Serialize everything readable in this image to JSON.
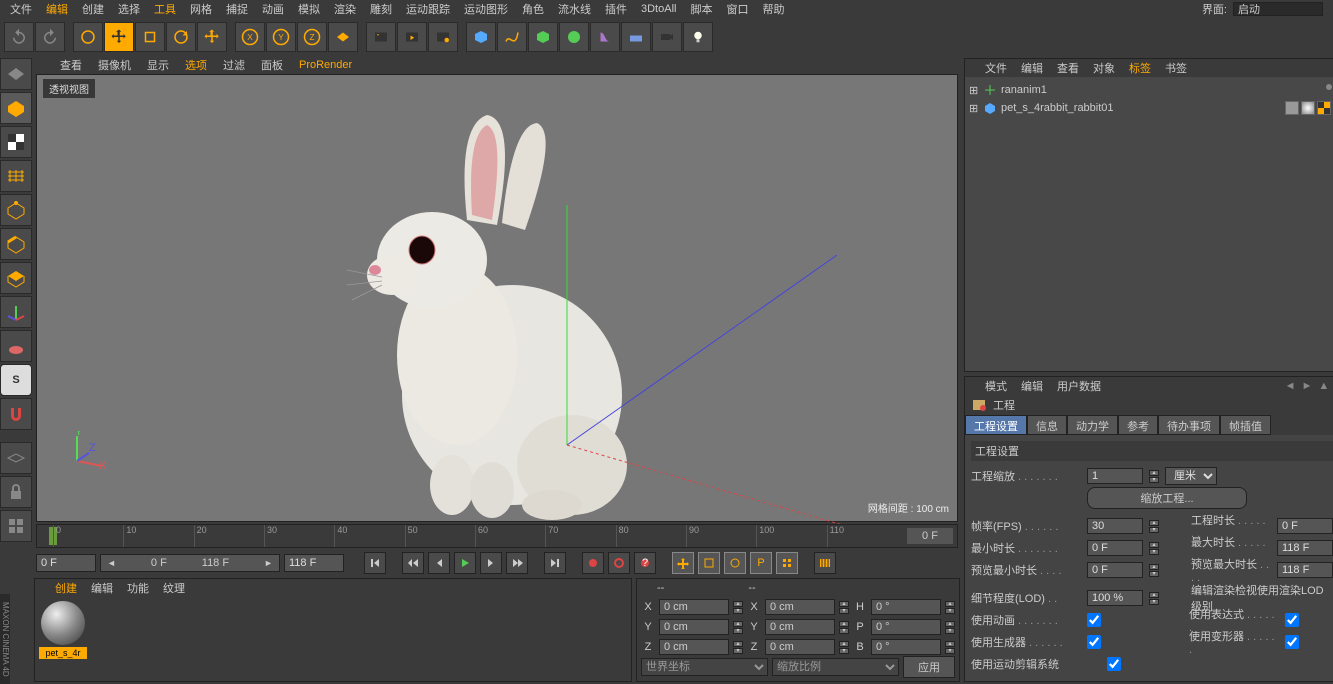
{
  "topmenu": [
    "文件",
    "编辑",
    "创建",
    "选择",
    "工具",
    "网格",
    "捕捉",
    "动画",
    "模拟",
    "渲染",
    "雕刻",
    "运动跟踪",
    "运动图形",
    "角色",
    "流水线",
    "插件",
    "3DtoAll",
    "脚本",
    "窗口",
    "帮助"
  ],
  "topmenu_hl": [
    1,
    4
  ],
  "interface_label": "界面:",
  "interface_value": "启动",
  "viewport_menu": [
    "查看",
    "摄像机",
    "显示",
    "选项",
    "过滤",
    "面板",
    "ProRender"
  ],
  "viewport_menu_hl": [
    3,
    6
  ],
  "vp_label": "透视视图",
  "vp_grid": "网格间距 : 100 cm",
  "timeline": {
    "ticks": [
      "0",
      "10",
      "20",
      "30",
      "40",
      "50",
      "60",
      "70",
      "80",
      "90",
      "100",
      "110"
    ],
    "current": "0 F"
  },
  "transport": {
    "start": "0 F",
    "slider_left": "0 F",
    "slider_right": "118 F",
    "end": "118 F"
  },
  "material": {
    "menu": [
      "创建",
      "编辑",
      "功能",
      "纹理"
    ],
    "menu_hl": [
      0
    ],
    "name": "pet_s_4r"
  },
  "coord": {
    "menu": [
      "--",
      "--"
    ],
    "X": "0 cm",
    "Y": "0 cm",
    "Z": "0 cm",
    "X2": "0 cm",
    "Y2": "0 cm",
    "Z2": "0 cm",
    "H": "0 °",
    "P": "0 °",
    "B": "0 °",
    "sys": "世界坐标",
    "scale": "缩放比例",
    "apply": "应用"
  },
  "objpanel": {
    "menu": [
      "文件",
      "编辑",
      "查看",
      "对象",
      "标签",
      "书签"
    ],
    "menu_hl": [
      4
    ],
    "items": [
      {
        "name": "rananim1",
        "icon": "#5c5"
      },
      {
        "name": "pet_s_4rabbit_rabbit01",
        "icon": "#5af"
      }
    ]
  },
  "attrpanel": {
    "menu": [
      "模式",
      "编辑",
      "用户数据"
    ],
    "title": "工程",
    "tabs": [
      "工程设置",
      "信息",
      "动力学",
      "参考",
      "待办事项",
      "帧插值"
    ],
    "active_tab": 0,
    "section": "工程设置",
    "rows": {
      "scale_label": "工程缩放",
      "scale_val": "1",
      "scale_unit": "厘米",
      "scale_btn": "缩放工程...",
      "fps_label": "帧率(FPS)",
      "fps_val": "30",
      "dur_label": "工程时长",
      "dur_val": "0 F",
      "mint_label": "最小时长",
      "mint_val": "0 F",
      "maxt_label": "最大时长",
      "maxt_val": "118 F",
      "pmin_label": "预览最小时长",
      "pmin_val": "0 F",
      "pmax_label": "预览最大时长",
      "pmax_val": "118 F",
      "lod_label": "细节程度(LOD)",
      "lod_val": "100 %",
      "lod_check_label": "编辑渲染检视使用渲染LOD级别",
      "anim_label": "使用动画",
      "expr_label": "使用表达式",
      "gen_label": "使用生成器",
      "def_label": "使用变形器",
      "mot_label": "使用运动剪辑系统"
    }
  },
  "brand": "MAXON CINEMA 4D"
}
